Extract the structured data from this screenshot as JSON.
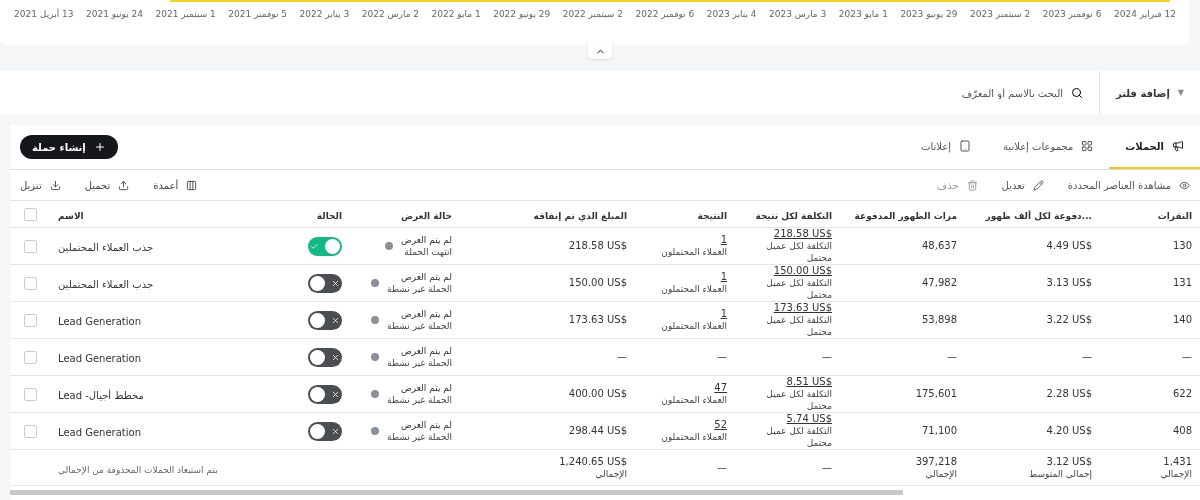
{
  "chart": {
    "axis_labels": [
      "12 فبراير 2024",
      "6 نوفمبر 2023",
      "2 سبتمبر 2023",
      "29 يونيو 2023",
      "1 مايو 2023",
      "3 مارس 2023",
      "4 يناير 2023",
      "6 نوفمبر 2022",
      "2 سبتمبر 2022",
      "29 يونيو 2022",
      "1 مايو 2022",
      "2 مارس 2022",
      "3 يناير 2022",
      "5 نوفمبر 2021",
      "1 سبتمبر 2021",
      "24 يونيو 2021",
      "13 أبريل 2021"
    ]
  },
  "filter_bar": {
    "caret": "▼",
    "add_filter": "إضافة فلتر",
    "search": {
      "placeholder": "البحث بالاسم أو المعرّف"
    }
  },
  "tabs": [
    {
      "label": "الحملات",
      "selected": true,
      "kind": "campaigns"
    },
    {
      "label": "مجموعات إعلانية",
      "selected": false,
      "kind": "adsets"
    },
    {
      "label": "إعلانات",
      "selected": false,
      "kind": "ads"
    }
  ],
  "create_button": "إنشاء حملة",
  "actions": [
    {
      "label": "مشاهدة العناصر المحددة",
      "kind": "view",
      "disabled": false
    },
    {
      "label": "تعديل",
      "kind": "edit",
      "disabled": false
    },
    {
      "label": "حذف",
      "kind": "delete",
      "disabled": true
    }
  ],
  "tools": [
    {
      "label": "أعمدة",
      "kind": "columns"
    },
    {
      "label": "تحميل",
      "kind": "upload"
    },
    {
      "label": "تنزيل",
      "kind": "download"
    }
  ],
  "table": {
    "select_all_checked": false,
    "columns": [
      "النقرات",
      "...دفوعة لكل ألف ظهور",
      "مرات الظهور المدفوعة",
      "التكلفة لكل نتيجة",
      "النتيجة",
      "المبلغ الذي تم إنفاقه",
      "حالة العرض",
      "الحالة",
      "الاسم"
    ],
    "rows": [
      {
        "checked": false,
        "clicks": "130",
        "cpm": "4.49 US$",
        "impressions": "48,637",
        "cost": "218.58 US$",
        "cost_note": "التكلفة لكل عميل محتمل",
        "result": "1",
        "result_note": "العملاء المحتملون",
        "spent": "218.58 US$",
        "delivery": "لم يتم العرض",
        "delivery_note": "انتهت الحملة",
        "on": true,
        "name": "جذب العملاء المحتملين"
      },
      {
        "checked": false,
        "clicks": "131",
        "cpm": "3.13 US$",
        "impressions": "47,982",
        "cost": "150.00 US$",
        "cost_note": "التكلفة لكل عميل محتمل",
        "result": "1",
        "result_note": "العملاء المحتملون",
        "spent": "150.00 US$",
        "delivery": "لم يتم العرض",
        "delivery_note": "الحملة غير نشطة",
        "on": false,
        "name": "جذب العملاء المحتملين"
      },
      {
        "checked": false,
        "clicks": "140",
        "cpm": "3.22 US$",
        "impressions": "53,898",
        "cost": "173.63 US$",
        "cost_note": "التكلفة لكل عميل محتمل",
        "result": "1",
        "result_note": "العملاء المحتملون",
        "spent": "173.63 US$",
        "delivery": "لم يتم العرض",
        "delivery_note": "الحملة غير نشطة",
        "on": false,
        "name": "Lead Generation"
      },
      {
        "checked": false,
        "clicks": "—",
        "cpm": "—",
        "impressions": "—",
        "cost": "—",
        "result": "—",
        "spent": "—",
        "delivery": "لم يتم العرض",
        "delivery_note": "الحملة غير نشطة",
        "on": false,
        "name": "Lead Generation"
      },
      {
        "checked": false,
        "clicks": "622",
        "cpm": "2.28 US$",
        "impressions": "175,601",
        "cost": "8.51 US$",
        "cost_note": "التكلفة لكل عميل محتمل",
        "result": "47",
        "result_note": "العملاء المحتملون",
        "spent": "400.00 US$",
        "delivery": "لم يتم العرض",
        "delivery_note": "الحملة غير نشطة",
        "on": false,
        "name": "مخطط أجيال- Lead"
      },
      {
        "checked": false,
        "clicks": "408",
        "cpm": "4.20 US$",
        "impressions": "71,100",
        "cost": "5.74 US$",
        "cost_note": "التكلفة لكل عميل محتمل",
        "result": "52",
        "result_note": "العملاء المحتملون",
        "spent": "298.44 US$",
        "delivery": "لم يتم العرض",
        "delivery_note": "الحملة غير نشطة",
        "on": false,
        "name": "Lead Generation"
      }
    ],
    "totals": {
      "clicks": "1,431",
      "clicks_note": "الإجمالي",
      "cpm": "3.12 US$",
      "cpm_note": "إجمالي المتوسط",
      "impressions": "397,218",
      "impressions_note": "الإجمالي",
      "cost": "—",
      "result": "—",
      "spent": "1,240.65 US$",
      "spent_note": "الإجمالي",
      "note": "يتم استبعاد الحملات المحذوفة من الإجمالي"
    }
  }
}
